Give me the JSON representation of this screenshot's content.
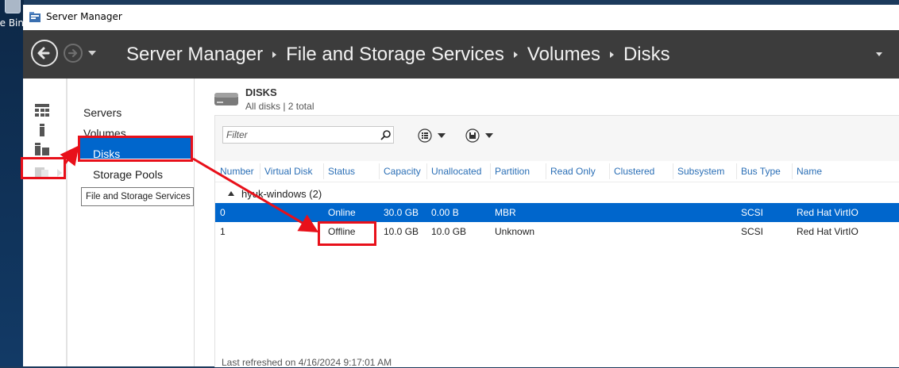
{
  "desktop": {
    "recycle_bin_label": "Recycle Bin"
  },
  "window": {
    "title": "Server Manager"
  },
  "breadcrumb": [
    "Server Manager",
    "File and Storage Services",
    "Volumes",
    "Disks"
  ],
  "nav": {
    "items": [
      {
        "label": "Servers"
      },
      {
        "label": "Volumes"
      },
      {
        "label": "Disks",
        "selected": true
      },
      {
        "label": "Storage Pools"
      }
    ]
  },
  "tooltip": "File and Storage Services",
  "disks": {
    "title": "DISKS",
    "subtitle": "All disks | 2 total",
    "filter_placeholder": "Filter",
    "columns": [
      "Number",
      "Virtual Disk",
      "Status",
      "Capacity",
      "Unallocated",
      "Partition",
      "Read Only",
      "Clustered",
      "Subsystem",
      "Bus Type",
      "Name"
    ],
    "group": "hyuk-windows (2)",
    "rows": [
      {
        "number": "0",
        "virtual_disk": "",
        "status": "Online",
        "capacity": "30.0 GB",
        "unallocated": "0.00 B",
        "partition": "MBR",
        "read_only": "",
        "clustered": "",
        "subsystem": "",
        "bus_type": "SCSI",
        "name": "Red Hat VirtIO",
        "selected": true
      },
      {
        "number": "1",
        "virtual_disk": "",
        "status": "Offline",
        "capacity": "10.0 GB",
        "unallocated": "10.0 GB",
        "partition": "Unknown",
        "read_only": "",
        "clustered": "",
        "subsystem": "",
        "bus_type": "SCSI",
        "name": "Red Hat VirtIO",
        "selected": false
      }
    ],
    "last_refreshed": "Last refreshed on 4/16/2024 9:17:01 AM"
  },
  "colors": {
    "nav_bar": "#3c3c3c",
    "selection": "#0066cc",
    "annotation": "#e8101a",
    "header_text": "#2b6fb6"
  }
}
